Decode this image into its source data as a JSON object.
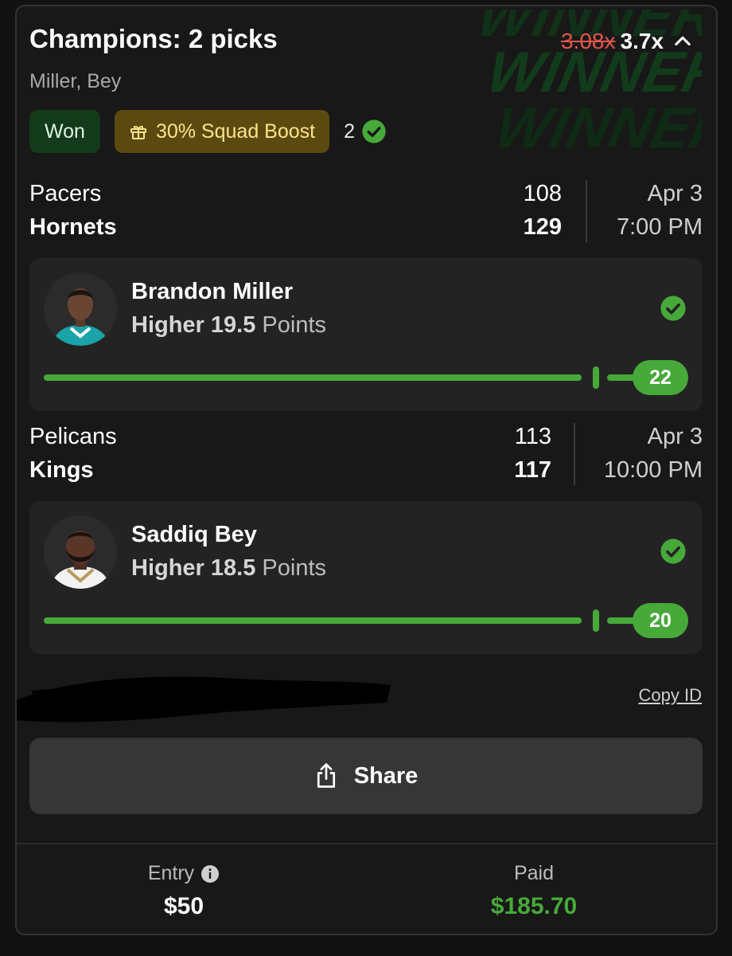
{
  "header": {
    "title": "Champions: 2 picks",
    "subtitle": "Miller, Bey",
    "multiplier_old": "3.08x",
    "multiplier_new": "3.7x",
    "watermark": [
      "WINNER!!",
      "WINNER!!",
      "WINNER!!"
    ]
  },
  "badges": {
    "status": "Won",
    "boost": "30% Squad Boost",
    "picks_correct": "2"
  },
  "games": [
    {
      "team_away": "Pacers",
      "team_home": "Hornets",
      "score_away": "108",
      "score_home": "129",
      "date": "Apr 3",
      "time": "7:00 PM"
    },
    {
      "team_away": "Pelicans",
      "team_home": "Kings",
      "score_away": "113",
      "score_home": "117",
      "date": "Apr 3",
      "time": "10:00 PM"
    }
  ],
  "picks": [
    {
      "player": "Brandon Miller",
      "direction": "Higher",
      "line": "19.5",
      "stat": "Points",
      "actual": "22"
    },
    {
      "player": "Saddiq Bey",
      "direction": "Higher",
      "line": "18.5",
      "stat": "Points",
      "actual": "20"
    }
  ],
  "actions": {
    "copy_id": "Copy ID",
    "share": "Share"
  },
  "footer": {
    "entry_label": "Entry",
    "entry_value": "$50",
    "paid_label": "Paid",
    "paid_value": "$185.70"
  },
  "colors": {
    "accent_green": "#47a93a",
    "strike_red": "#e0574b",
    "boost_gold": "#5b4a10"
  }
}
